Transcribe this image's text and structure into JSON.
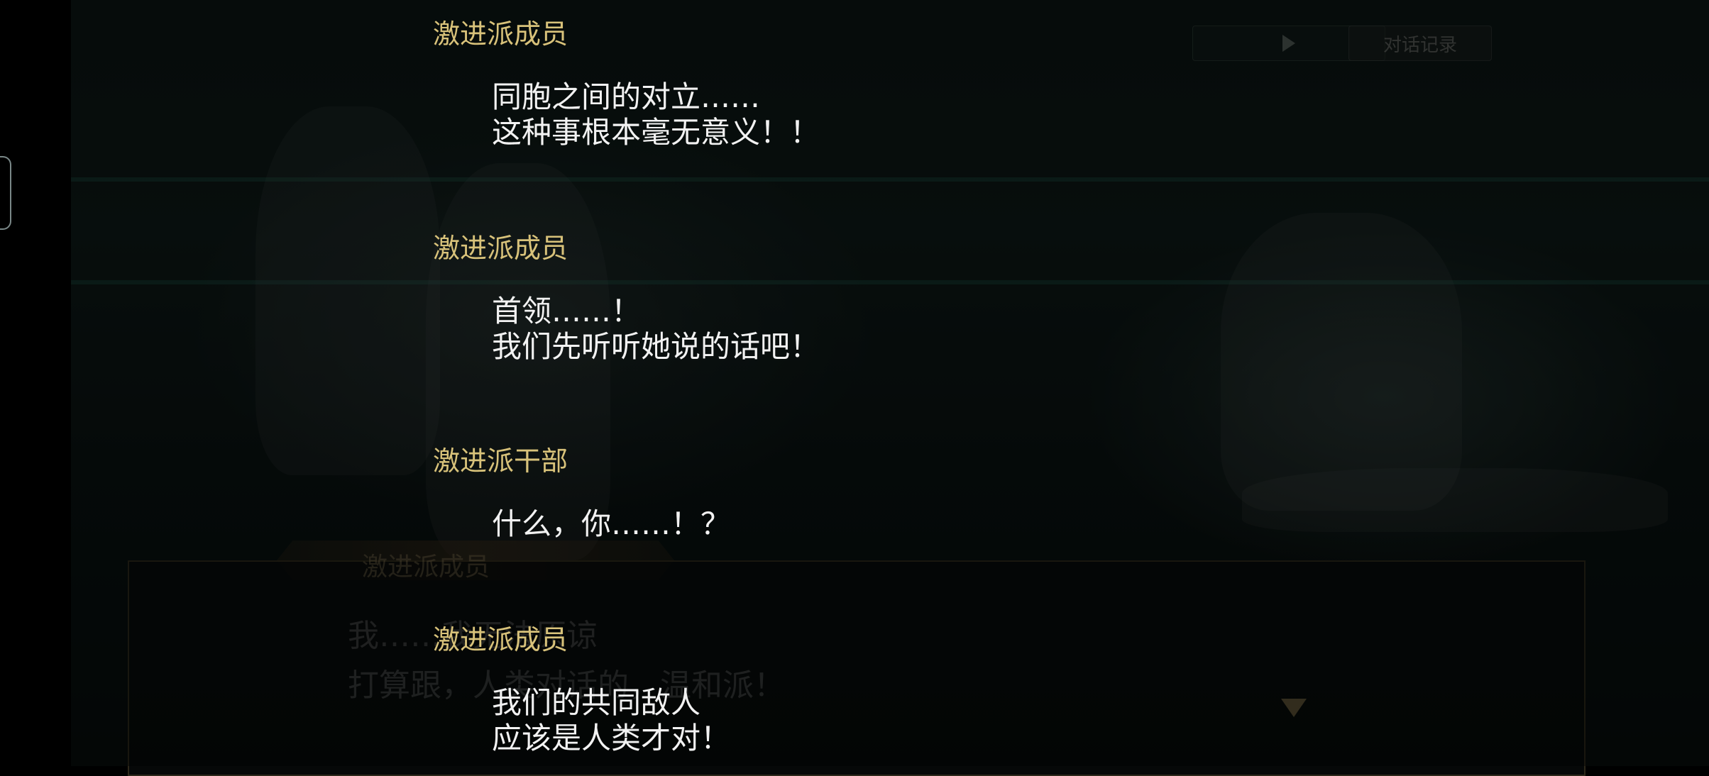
{
  "top_controls": {
    "play_icon": "play-icon",
    "log_label": "对话记录"
  },
  "dialog": {
    "speaker": "激进派成员",
    "lines": [
      "我……我无法原谅",
      "打算跟，人类对话的，温和派！"
    ],
    "next_icon": "chevron-down-icon"
  },
  "log": [
    {
      "speaker": "激进派成员",
      "lines": [
        "同胞之间的对立……",
        "这种事根本毫无意义！！"
      ]
    },
    {
      "speaker": "激进派成员",
      "lines": [
        "首领……！",
        "我们先听听她说的话吧！"
      ]
    },
    {
      "speaker": "激进派干部",
      "lines": [
        "什么，你……！？"
      ]
    },
    {
      "speaker": "激进派成员",
      "lines": [
        "我们的共同敌人",
        "应该是人类才对！"
      ]
    }
  ],
  "colors": {
    "speaker_name": "#d8c27a",
    "dialog_text": "#f2f2f2"
  }
}
